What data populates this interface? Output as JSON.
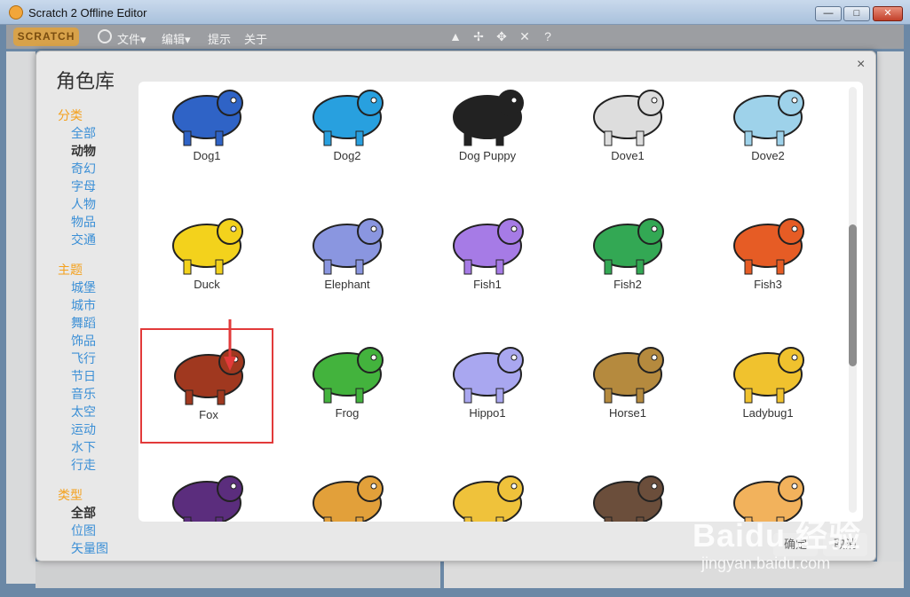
{
  "window": {
    "title": "Scratch 2 Offline Editor",
    "minimize_glyph": "—",
    "maximize_glyph": "□",
    "close_glyph": "✕"
  },
  "menubar": {
    "logo": "SCRATCH",
    "menus": [
      "文件▾",
      "编辑▾",
      "提示",
      "关于"
    ],
    "tools": [
      "stamp-icon",
      "cut-icon",
      "grow-icon",
      "shrink-icon",
      "help-icon"
    ]
  },
  "library": {
    "title": "角色库",
    "close": "×",
    "groups": [
      {
        "title": "分类",
        "items": [
          "全部",
          "动物",
          "奇幻",
          "字母",
          "人物",
          "物品",
          "交通"
        ],
        "active": 1
      },
      {
        "title": "主题",
        "items": [
          "城堡",
          "城市",
          "舞蹈",
          "饰品",
          "飞行",
          "节日",
          "音乐",
          "太空",
          "运动",
          "水下",
          "行走"
        ],
        "active": -1
      },
      {
        "title": "类型",
        "items": [
          "全部",
          "位图",
          "矢量图"
        ],
        "active": 0
      }
    ],
    "sprites": [
      "Dog1",
      "Dog2",
      "Dog Puppy",
      "Dove1",
      "Dove2",
      "Duck",
      "Elephant",
      "Fish1",
      "Fish2",
      "Fish3",
      "Fox",
      "Frog",
      "Hippo1",
      "Horse1",
      "Ladybug1",
      "",
      "",
      "",
      "",
      ""
    ],
    "selected_sprite": "Fox",
    "ok_button": "确定",
    "cancel_button": "取消"
  },
  "watermark": {
    "main": "Baidu 经验",
    "sub": "jingyan.baidu.com"
  },
  "colors": {
    "category_title": "#f4a11d",
    "link": "#3b8fd6",
    "selection": "#e23a3a"
  }
}
